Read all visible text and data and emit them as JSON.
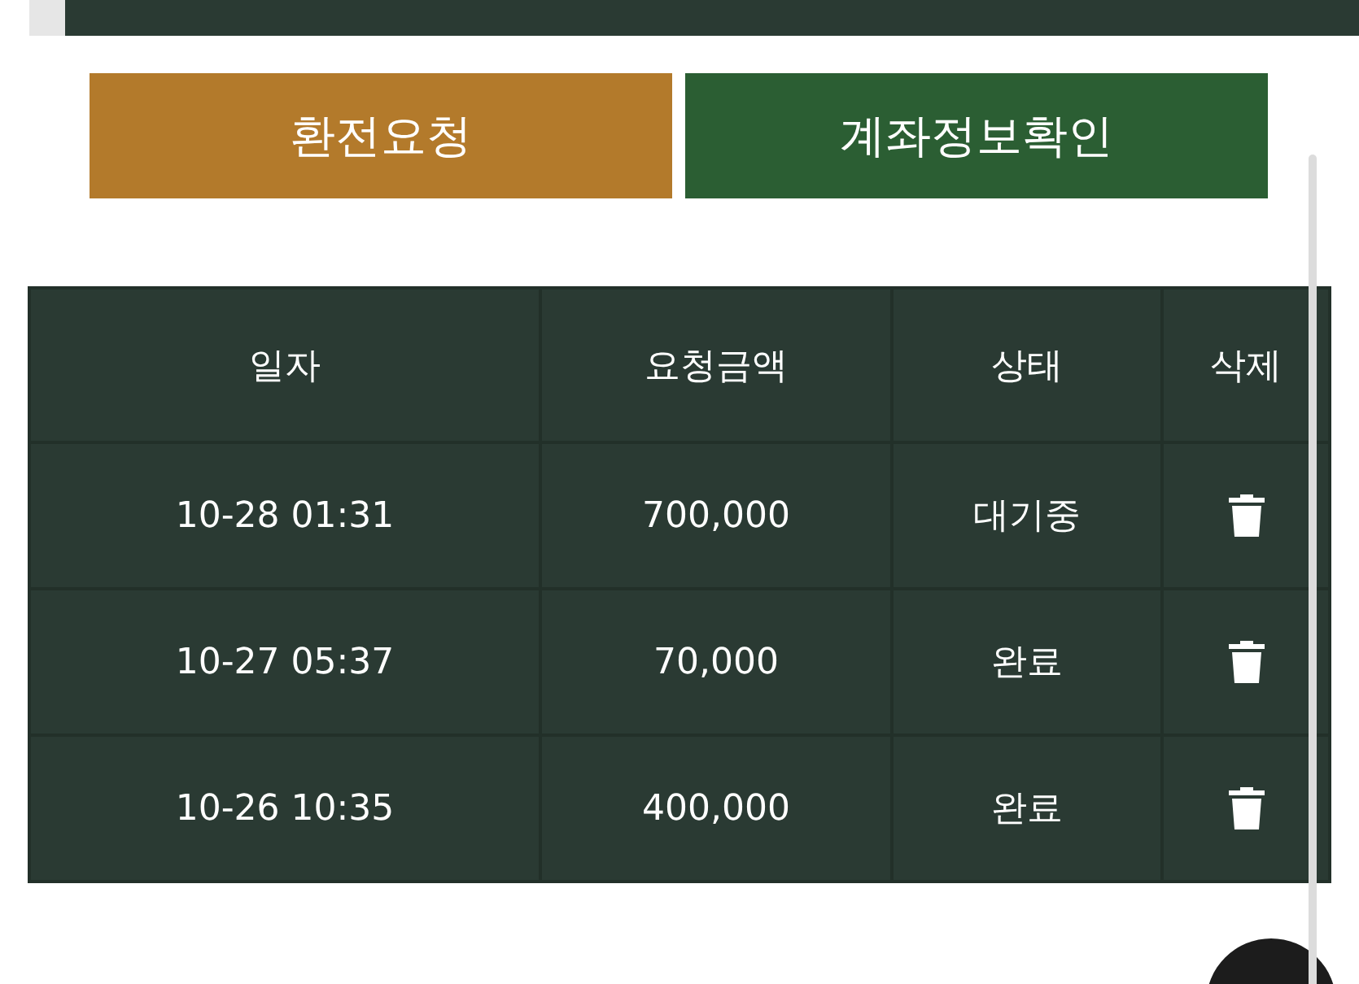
{
  "buttons": [
    {
      "label": "환전요청",
      "kind": "exchange"
    },
    {
      "label": "계좌정보확인",
      "kind": "account"
    }
  ],
  "table": {
    "columns": [
      "일자",
      "요청금액",
      "상태",
      "삭제"
    ],
    "rows": [
      {
        "date": "10-28 01:31",
        "amount": "700,000",
        "status": "대기중"
      },
      {
        "date": "10-27 05:37",
        "amount": "70,000",
        "status": "완료"
      },
      {
        "date": "10-26 10:35",
        "amount": "400,000",
        "status": "완료"
      }
    ]
  }
}
